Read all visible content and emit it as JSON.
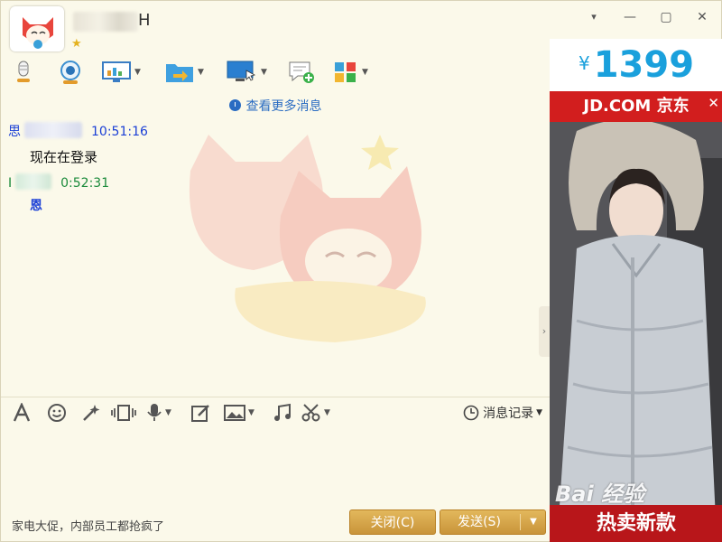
{
  "title": {
    "contact_name_suffix": "H"
  },
  "window_controls": {
    "menu": "▾",
    "minimize": "—",
    "maximize": "▢",
    "close": "✕"
  },
  "toolbar": {
    "items": [
      {
        "name": "voice-call",
        "icon": "microphone-icon",
        "has_arrow": false
      },
      {
        "name": "video-call",
        "icon": "webcam-icon",
        "has_arrow": false
      },
      {
        "name": "remote-assist",
        "icon": "presentation-icon",
        "has_arrow": true
      },
      {
        "name": "send-file",
        "icon": "folder-transfer-icon",
        "has_arrow": true
      },
      {
        "name": "remote-desktop",
        "icon": "monitor-cursor-icon",
        "has_arrow": true
      },
      {
        "name": "create-discussion",
        "icon": "chat-add-icon",
        "has_arrow": false
      },
      {
        "name": "apps",
        "icon": "apps-grid-icon",
        "has_arrow": true
      }
    ]
  },
  "chat": {
    "view_more": "查看更多消息",
    "messages": [
      {
        "sender_prefix": "思",
        "time": "10:51:16",
        "body": "现在在登录",
        "color": "#1a3fd6"
      },
      {
        "sender_prefix": "I",
        "time": "0:52:31",
        "body": "恩",
        "color": "#1a8a3a"
      }
    ]
  },
  "input_toolbar": {
    "history_label": "消息记录"
  },
  "footer": {
    "ad_text": "家电大促，内部员工都抢疯了",
    "close_label": "关闭(C)",
    "send_label": "发送(S)"
  },
  "ad": {
    "currency": "¥",
    "price": "1399",
    "brand": "JD.COM 京东",
    "tagline": "热卖新款",
    "watermark": "Bai 经验",
    "colors": {
      "price": "#1aa0dc",
      "jd_red": "#d21e1e"
    }
  },
  "colors": {
    "button_gold": "#d4a347",
    "link_blue": "#2a6cc2",
    "background": "#fbf9ea"
  }
}
